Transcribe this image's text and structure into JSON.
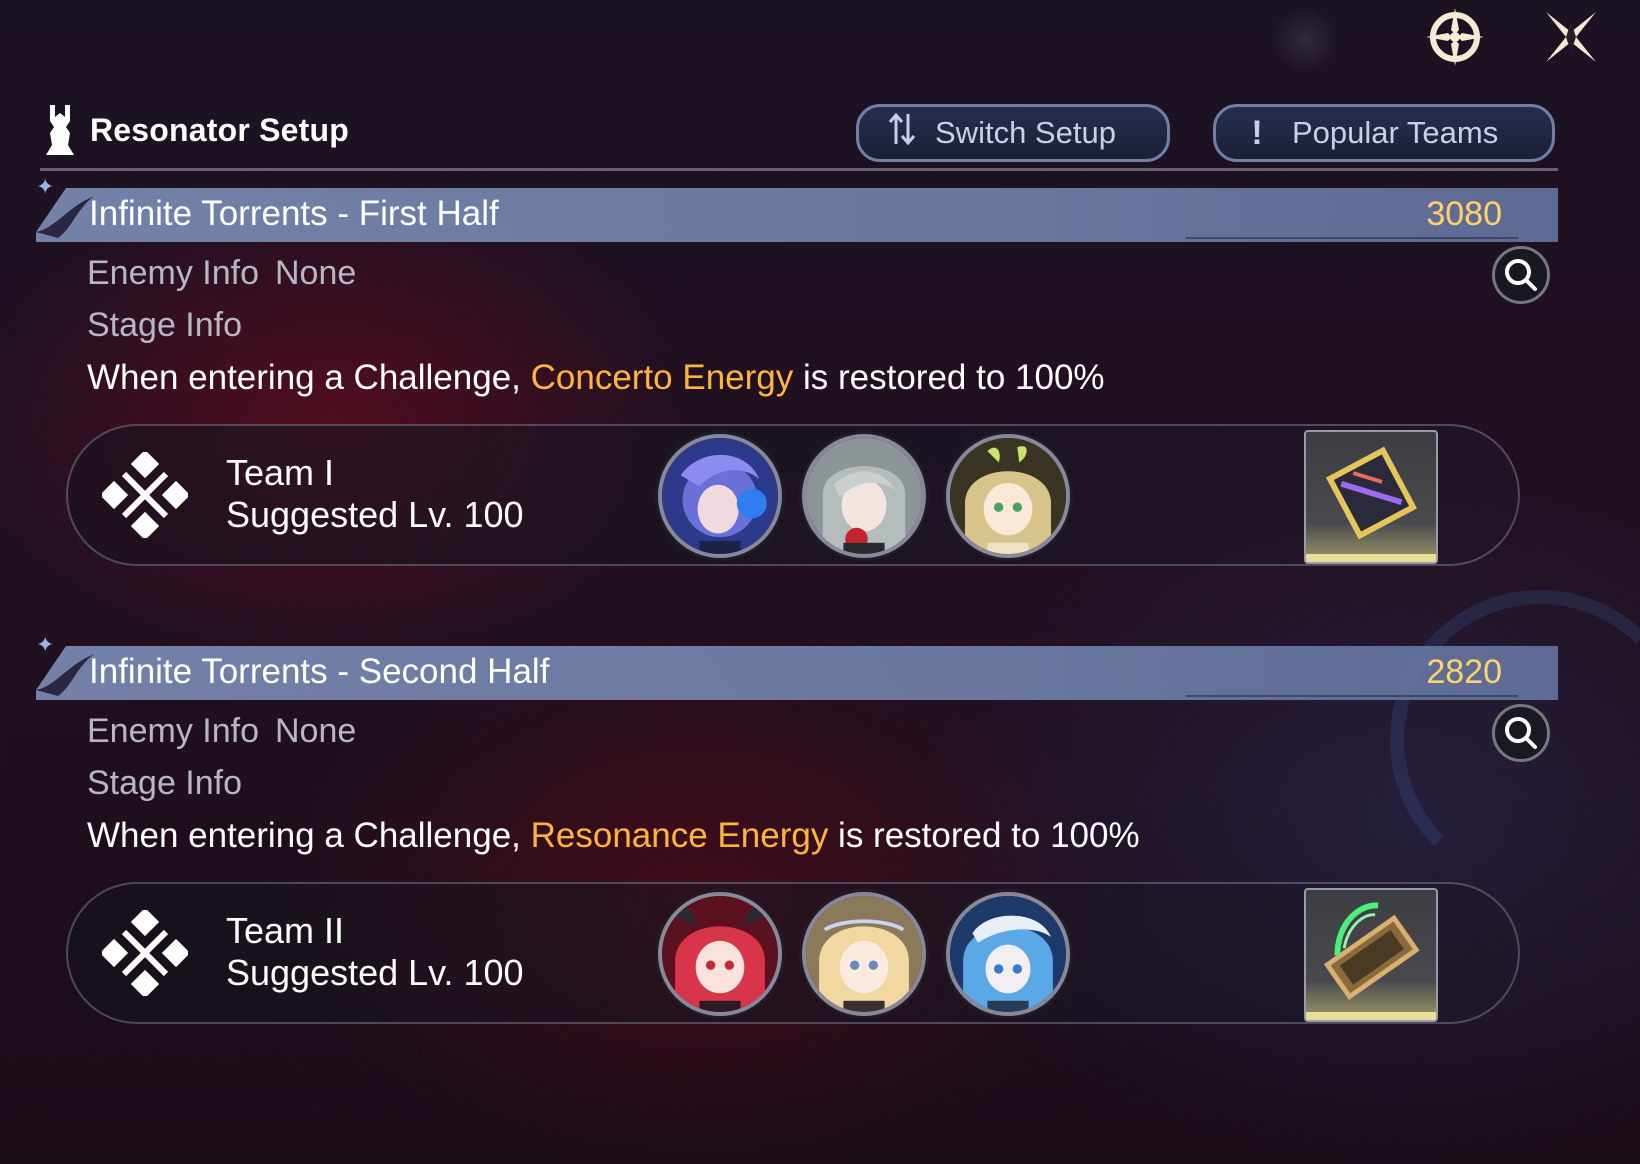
{
  "header": {
    "title": "Resonator Setup",
    "switch_setup_label": "Switch Setup",
    "popular_teams_label": "Popular Teams"
  },
  "top_icons": [
    "target-icon",
    "close-icon"
  ],
  "sections": [
    {
      "title": "Infinite Torrents - First Half",
      "score": "3080",
      "enemy_info_label": "Enemy Info",
      "enemy_info_value": "None",
      "stage_info_label": "Stage Info",
      "description_prefix": "When entering a Challenge, ",
      "description_highlight": "Concerto Energy",
      "description_suffix": " is restored to 100%",
      "team": {
        "name": "Team I",
        "level": "Suggested Lv. 100"
      }
    },
    {
      "title": "Infinite Torrents - Second Half",
      "score": "2820",
      "enemy_info_label": "Enemy Info",
      "enemy_info_value": "None",
      "stage_info_label": "Stage Info",
      "description_prefix": "When entering a Challenge, ",
      "description_highlight": "Resonance Energy",
      "description_suffix": " is restored to 100%",
      "team": {
        "name": "Team II",
        "level": "Suggested Lv. 100"
      }
    }
  ],
  "colors": {
    "score": "#ffd36a",
    "highlight": "#ffb43c",
    "bar": "#7887af"
  }
}
